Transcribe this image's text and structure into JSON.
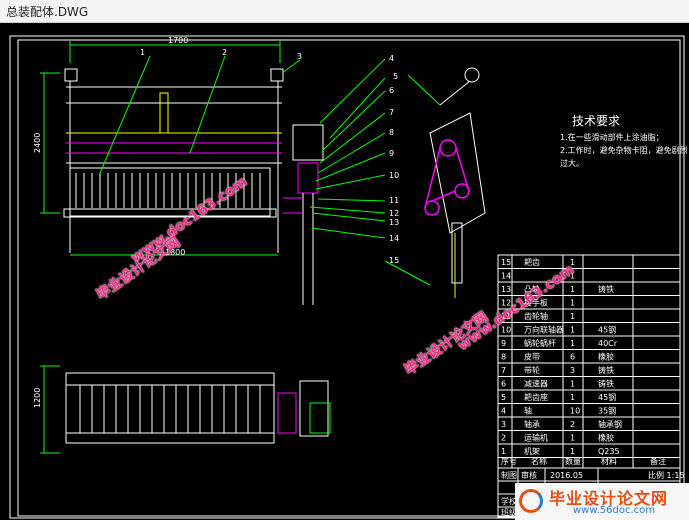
{
  "window": {
    "title": "总装配体.DWG"
  },
  "dimensions": {
    "top_width": "1700",
    "height_left": "2400",
    "bottom_width": "1800",
    "height_lower": "1200"
  },
  "callouts": [
    "1",
    "2",
    "3",
    "4",
    "5",
    "6",
    "7",
    "8",
    "9",
    "10",
    "11",
    "12",
    "13",
    "14",
    "15"
  ],
  "tech": {
    "title": "技术要求",
    "line1": "1.在一些滑动部件上涂油脂；",
    "line2": "2.工作时，避免杂物卡阻，避免剧烈",
    "line3": "过大。"
  },
  "bom": {
    "rows": [
      {
        "no": "15",
        "name": "耙齿",
        "qty": "1",
        "material": "",
        "note": ""
      },
      {
        "no": "14",
        "name": "",
        "qty": "1",
        "material": "",
        "note": ""
      },
      {
        "no": "13",
        "name": "凸轮",
        "qty": "1",
        "material": "铸铁",
        "note": ""
      },
      {
        "no": "12",
        "name": "接手板",
        "qty": "1",
        "material": "",
        "note": ""
      },
      {
        "no": "11",
        "name": "齿轮轴",
        "qty": "1",
        "material": "",
        "note": ""
      },
      {
        "no": "10",
        "name": "万向联轴器",
        "qty": "1",
        "material": "45钢",
        "note": ""
      },
      {
        "no": "9",
        "name": "蜗轮蜗杆",
        "qty": "1",
        "material": "40Cr",
        "note": ""
      },
      {
        "no": "8",
        "name": "皮带",
        "qty": "6",
        "material": "橡胶",
        "note": ""
      },
      {
        "no": "7",
        "name": "带轮",
        "qty": "3",
        "material": "铸铁",
        "note": ""
      },
      {
        "no": "6",
        "name": "减速器",
        "qty": "1",
        "material": "铸铁",
        "note": ""
      },
      {
        "no": "5",
        "name": "耙齿座",
        "qty": "1",
        "material": "45钢",
        "note": ""
      },
      {
        "no": "4",
        "name": "轴",
        "qty": "10",
        "material": "35钢",
        "note": ""
      },
      {
        "no": "3",
        "name": "轴承",
        "qty": "2",
        "material": "轴承钢",
        "note": ""
      },
      {
        "no": "2",
        "name": "运输机",
        "qty": "1",
        "material": "橡胶",
        "note": ""
      },
      {
        "no": "1",
        "name": "机架",
        "qty": "1",
        "material": "Q235",
        "note": ""
      }
    ],
    "header": {
      "no": "序号",
      "name": "名称",
      "qty": "数量",
      "material": "材料",
      "note": "备注"
    },
    "footer": {
      "row1_a": "制图",
      "row1_b": "审核",
      "date": "2016.05",
      "scale": "比例 1:15",
      "row2": "学校",
      "row3": "班级"
    }
  },
  "watermarks": {
    "site": "www.doc163.com",
    "brand": "毕业设计论文网"
  },
  "logo": {
    "text": "毕业设计论文网",
    "url": "www.56doc.com"
  }
}
